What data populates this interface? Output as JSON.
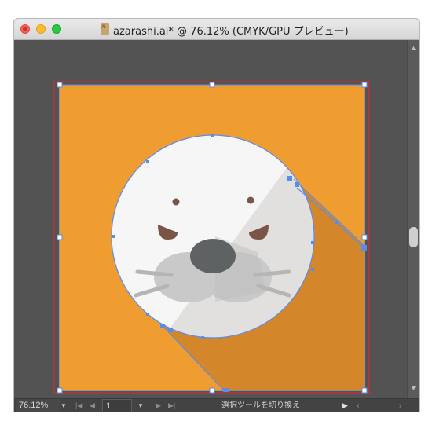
{
  "window": {
    "title": "azarashi.ai* @ 76.12% (CMYK/GPU プレビュー)",
    "doc_icon_label": "Ai",
    "buttons": [
      "close",
      "minimize",
      "maximize"
    ]
  },
  "canvas": {
    "artboard_color": "#ef9d31",
    "shadow_color": "#d3872a",
    "face_color": "#f6f6f6",
    "face_shade_color": "#e2e0de",
    "muzzle_color": "#c9c9c9",
    "nose_color": "#5f6263",
    "eye_color": "#7a5445",
    "selection_color": "#5a8de8",
    "artboard_border_color": "#cf2a36"
  },
  "status_bar": {
    "zoom": "76.12%",
    "page": "1",
    "tool_status": "選択ツールを切り換え",
    "nav_icons": [
      "first-page-icon",
      "previous-page-icon",
      "next-page-icon",
      "last-page-icon"
    ]
  }
}
